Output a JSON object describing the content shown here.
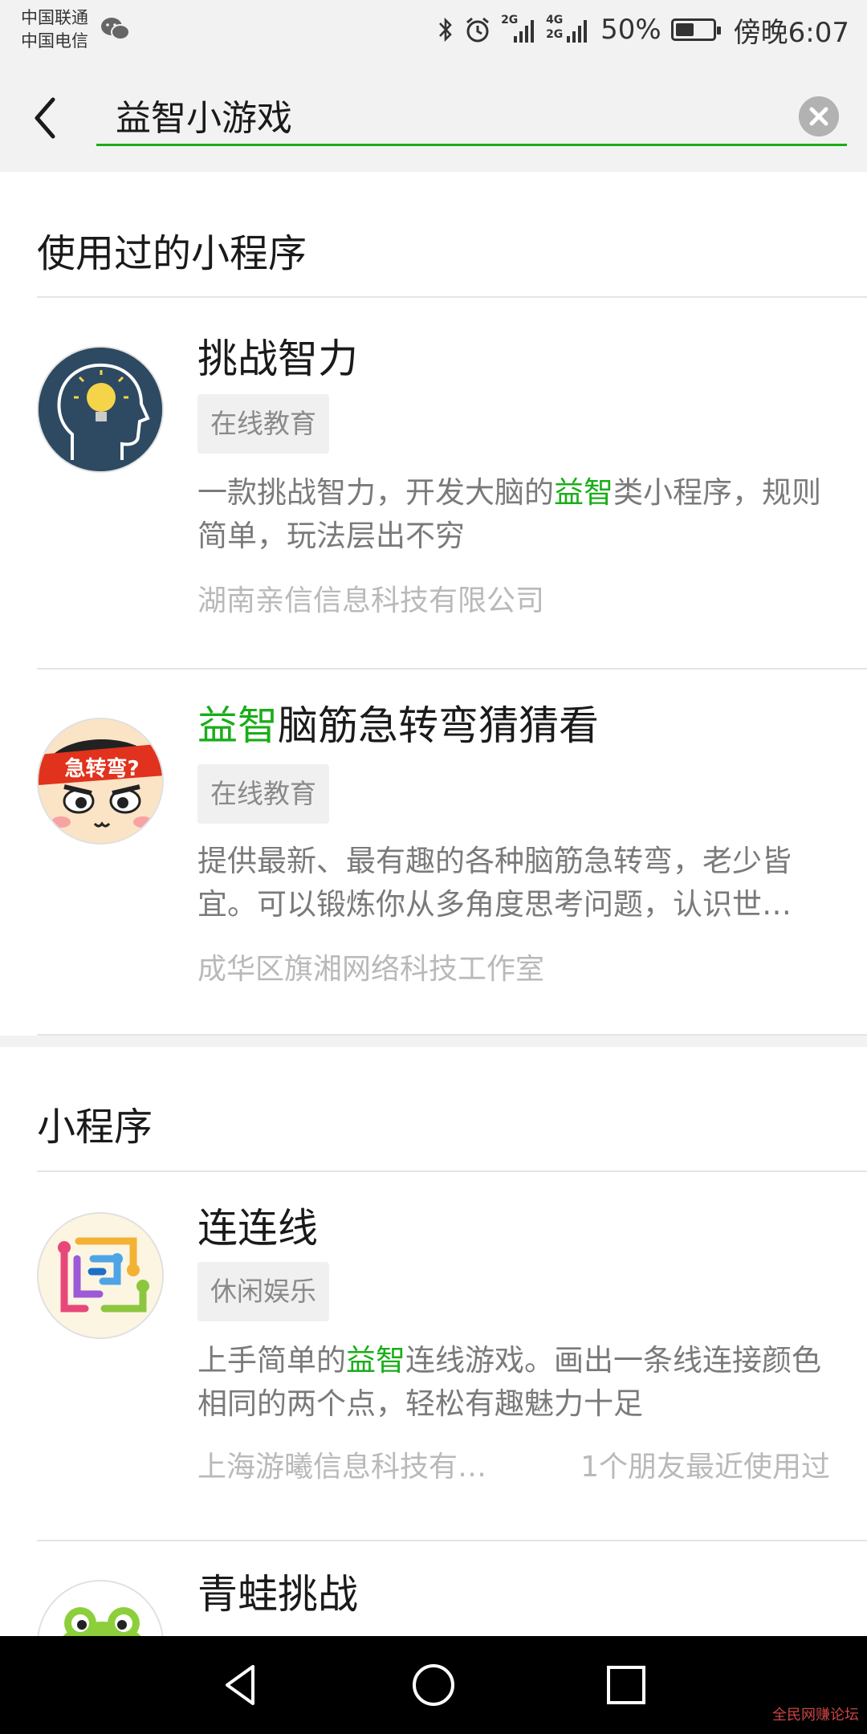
{
  "status_bar": {
    "carrier_1": "中国联通",
    "carrier_2": "中国电信",
    "net_top": "2G",
    "net_mid_1": "4G",
    "net_mid_2": "2G",
    "battery_percent": "50%",
    "battery_level": 0.5,
    "time": "傍晚6:07"
  },
  "search": {
    "query": "益智小游戏",
    "back_icon": "chevron-left-icon",
    "clear_icon": "clear-circle-icon"
  },
  "sections": [
    {
      "title": "使用过的小程序",
      "items": [
        {
          "title_highlight": "",
          "title_rest": "挑战智力",
          "tag": "在线教育",
          "desc_before": "一款挑战智力，开发大脑的",
          "desc_highlight": "益智",
          "desc_after": "类小程序，规则简单，玩法层出不穷",
          "company": "湖南亲信信息科技有限公司",
          "friends": "",
          "avatar_icon": "lightbulb-head-icon"
        },
        {
          "title_highlight": "益智",
          "title_rest": "脑筋急转弯猜猜看",
          "tag": "在线教育",
          "desc_before": "提供最新、最有趣的各种脑筋急转弯，老少皆宜。可以锻炼你从多角度思考问题，认识世…",
          "desc_highlight": "",
          "desc_after": "",
          "company": "成华区旗湘网络科技工作室",
          "friends": "",
          "avatar_icon": "cartoon-boy-icon",
          "avatar_text": "急转弯?"
        }
      ]
    },
    {
      "title": "小程序",
      "items": [
        {
          "title_highlight": "",
          "title_rest": "连连线",
          "tag": "休闲娱乐",
          "desc_before": "上手简单的",
          "desc_highlight": "益智",
          "desc_after": "连线游戏。画出一条线连接颜色相同的两个点，轻松有趣魅力十足",
          "company": "上海游曦信息科技有…",
          "friends": "1个朋友最近使用过",
          "avatar_icon": "connect-lines-icon"
        },
        {
          "title_highlight": "",
          "title_rest": "青蛙挑战",
          "avatar_icon": "frog-icon"
        }
      ]
    }
  ],
  "nav": {
    "back_icon": "nav-back-icon",
    "home_icon": "nav-home-icon",
    "recents_icon": "nav-recents-icon"
  },
  "watermark": "全民网赚论坛",
  "colors": {
    "accent": "#1aad19",
    "background": "#f2f2f2",
    "card": "#ffffff"
  }
}
